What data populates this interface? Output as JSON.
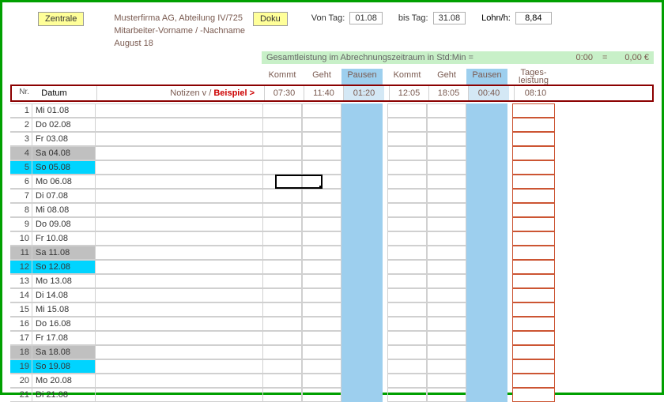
{
  "buttons": {
    "zentrale": "Zentrale",
    "doku": "Doku"
  },
  "info": {
    "firma": "Musterfirma AG, Abteilung IV/725",
    "mitarbeiter": "Mitarbeiter-Vorname / -Nachname",
    "monat": "August 18"
  },
  "range": {
    "von_label": "Von Tag:",
    "von": "01.08",
    "bis_label": "bis Tag:",
    "bis": "31.08"
  },
  "lohn": {
    "label": "Lohn/h:",
    "value": "8,84"
  },
  "summary": {
    "label": "Gesamtleistung im Abrechnungszeitraum in Std:Min =",
    "total": "0:00",
    "eq": "=",
    "euro": "0,00 €"
  },
  "cols": {
    "datum": "Datum",
    "kommt": "Kommt",
    "geht": "Geht",
    "pausen": "Pausen",
    "tages1": "Tages-",
    "tages2": "leistung",
    "nr": "Nr."
  },
  "notizen": {
    "pre": "Notizen v / ",
    "ex": "Beispiel >"
  },
  "example": {
    "kommt1": "07:30",
    "geht1": "11:40",
    "pausen1": "01:20",
    "kommt2": "12:05",
    "geht2": "18:05",
    "pausen2": "00:40",
    "day": "08:10"
  },
  "rows": [
    {
      "nr": "1",
      "date": "Mi 01.08",
      "t": ""
    },
    {
      "nr": "2",
      "date": "Do 02.08",
      "t": ""
    },
    {
      "nr": "3",
      "date": "Fr 03.08",
      "t": ""
    },
    {
      "nr": "4",
      "date": "Sa 04.08",
      "t": "sat"
    },
    {
      "nr": "5",
      "date": "So 05.08",
      "t": "sun"
    },
    {
      "nr": "6",
      "date": "Mo 06.08",
      "t": ""
    },
    {
      "nr": "7",
      "date": "Di 07.08",
      "t": ""
    },
    {
      "nr": "8",
      "date": "Mi 08.08",
      "t": ""
    },
    {
      "nr": "9",
      "date": "Do 09.08",
      "t": ""
    },
    {
      "nr": "10",
      "date": "Fr 10.08",
      "t": ""
    },
    {
      "nr": "11",
      "date": "Sa 11.08",
      "t": "sat"
    },
    {
      "nr": "12",
      "date": "So 12.08",
      "t": "sun"
    },
    {
      "nr": "13",
      "date": "Mo 13.08",
      "t": ""
    },
    {
      "nr": "14",
      "date": "Di 14.08",
      "t": ""
    },
    {
      "nr": "15",
      "date": "Mi 15.08",
      "t": ""
    },
    {
      "nr": "16",
      "date": "Do 16.08",
      "t": ""
    },
    {
      "nr": "17",
      "date": "Fr 17.08",
      "t": ""
    },
    {
      "nr": "18",
      "date": "Sa 18.08",
      "t": "sat"
    },
    {
      "nr": "19",
      "date": "So 19.08",
      "t": "sun"
    },
    {
      "nr": "20",
      "date": "Mo 20.08",
      "t": ""
    },
    {
      "nr": "21",
      "date": "Di 21.08",
      "t": ""
    }
  ]
}
